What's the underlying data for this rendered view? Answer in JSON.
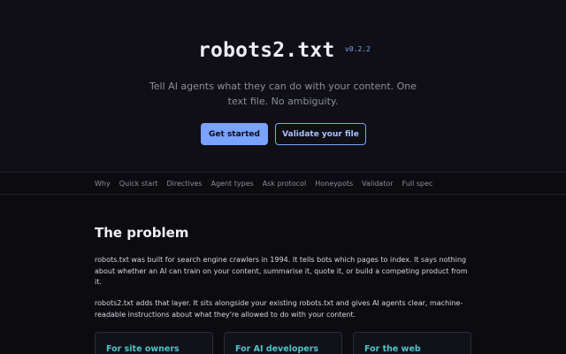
{
  "header": {
    "title": "robots2.txt",
    "version": "v0.2.2",
    "tagline": "Tell AI agents what they can do with your content. One text file. No ambiguity.",
    "primary_button": "Get started",
    "secondary_button": "Validate your file"
  },
  "nav": {
    "items": [
      "Why",
      "Quick start",
      "Directives",
      "Agent types",
      "Ask protocol",
      "Honeypots",
      "Validator",
      "Full spec"
    ]
  },
  "section": {
    "title": "The problem",
    "paragraph1": "robots.txt was built for search engine crawlers in 1994. It tells bots which pages to index. It says nothing about whether an AI can train on your content, summarise it, quote it, or build a competing product from it.",
    "paragraph2": "robots2.txt adds that layer. It sits alongside your existing robots.txt and gives AI agents clear, machine-readable instructions about what they're allowed to do with your content."
  },
  "cards": [
    {
      "title": "For site owners"
    },
    {
      "title": "For AI developers"
    },
    {
      "title": "For the web"
    }
  ],
  "colors": {
    "background": "#0b0b10",
    "accent": "#7aa2ff",
    "card_title": "#4fc3c9"
  }
}
